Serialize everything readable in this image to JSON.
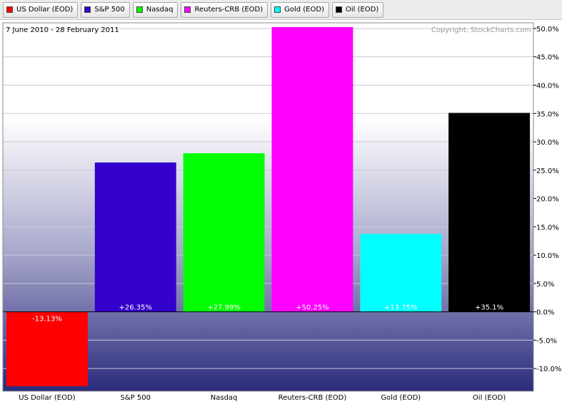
{
  "legend": [
    {
      "label": "US Dollar (EOD)",
      "color": "#ff0000"
    },
    {
      "label": "S&P 500",
      "color": "#3300cc"
    },
    {
      "label": "Nasdaq",
      "color": "#00ff00"
    },
    {
      "label": "Reuters-CRB (EOD)",
      "color": "#ff00ff"
    },
    {
      "label": "Gold (EOD)",
      "color": "#00ffff"
    },
    {
      "label": "Oil (EOD)",
      "color": "#000000"
    }
  ],
  "chart_data": {
    "type": "bar",
    "date_range": "7 June 2010 - 28 February 2011",
    "copyright": "Copyright, StockCharts.com",
    "categories": [
      "US Dollar (EOD)",
      "S&P 500",
      "Nasdaq",
      "Reuters-CRB (EOD)",
      "Gold (EOD)",
      "Oil (EOD)"
    ],
    "values": [
      -13.13,
      26.35,
      27.99,
      50.25,
      13.75,
      35.1
    ],
    "value_labels": [
      "-13.13%",
      "+26.35%",
      "+27.99%",
      "+50.25%",
      "+13.75%",
      "+35.1%"
    ],
    "colors": [
      "#ff0000",
      "#3300cc",
      "#00ff00",
      "#ff00ff",
      "#00ffff",
      "#000000"
    ],
    "ylim": [
      -14,
      51
    ],
    "yticks": [
      -10,
      -5,
      0,
      5,
      10,
      15,
      20,
      25,
      30,
      35,
      40,
      45,
      50
    ],
    "ytick_labels": [
      "-10.0%",
      "-5.0%",
      "0.0%",
      "5.0%",
      "10.0%",
      "15.0%",
      "20.0%",
      "25.0%",
      "30.0%",
      "35.0%",
      "40.0%",
      "45.0%",
      "50.0%"
    ],
    "grid": true,
    "yaxis_side": "right"
  }
}
